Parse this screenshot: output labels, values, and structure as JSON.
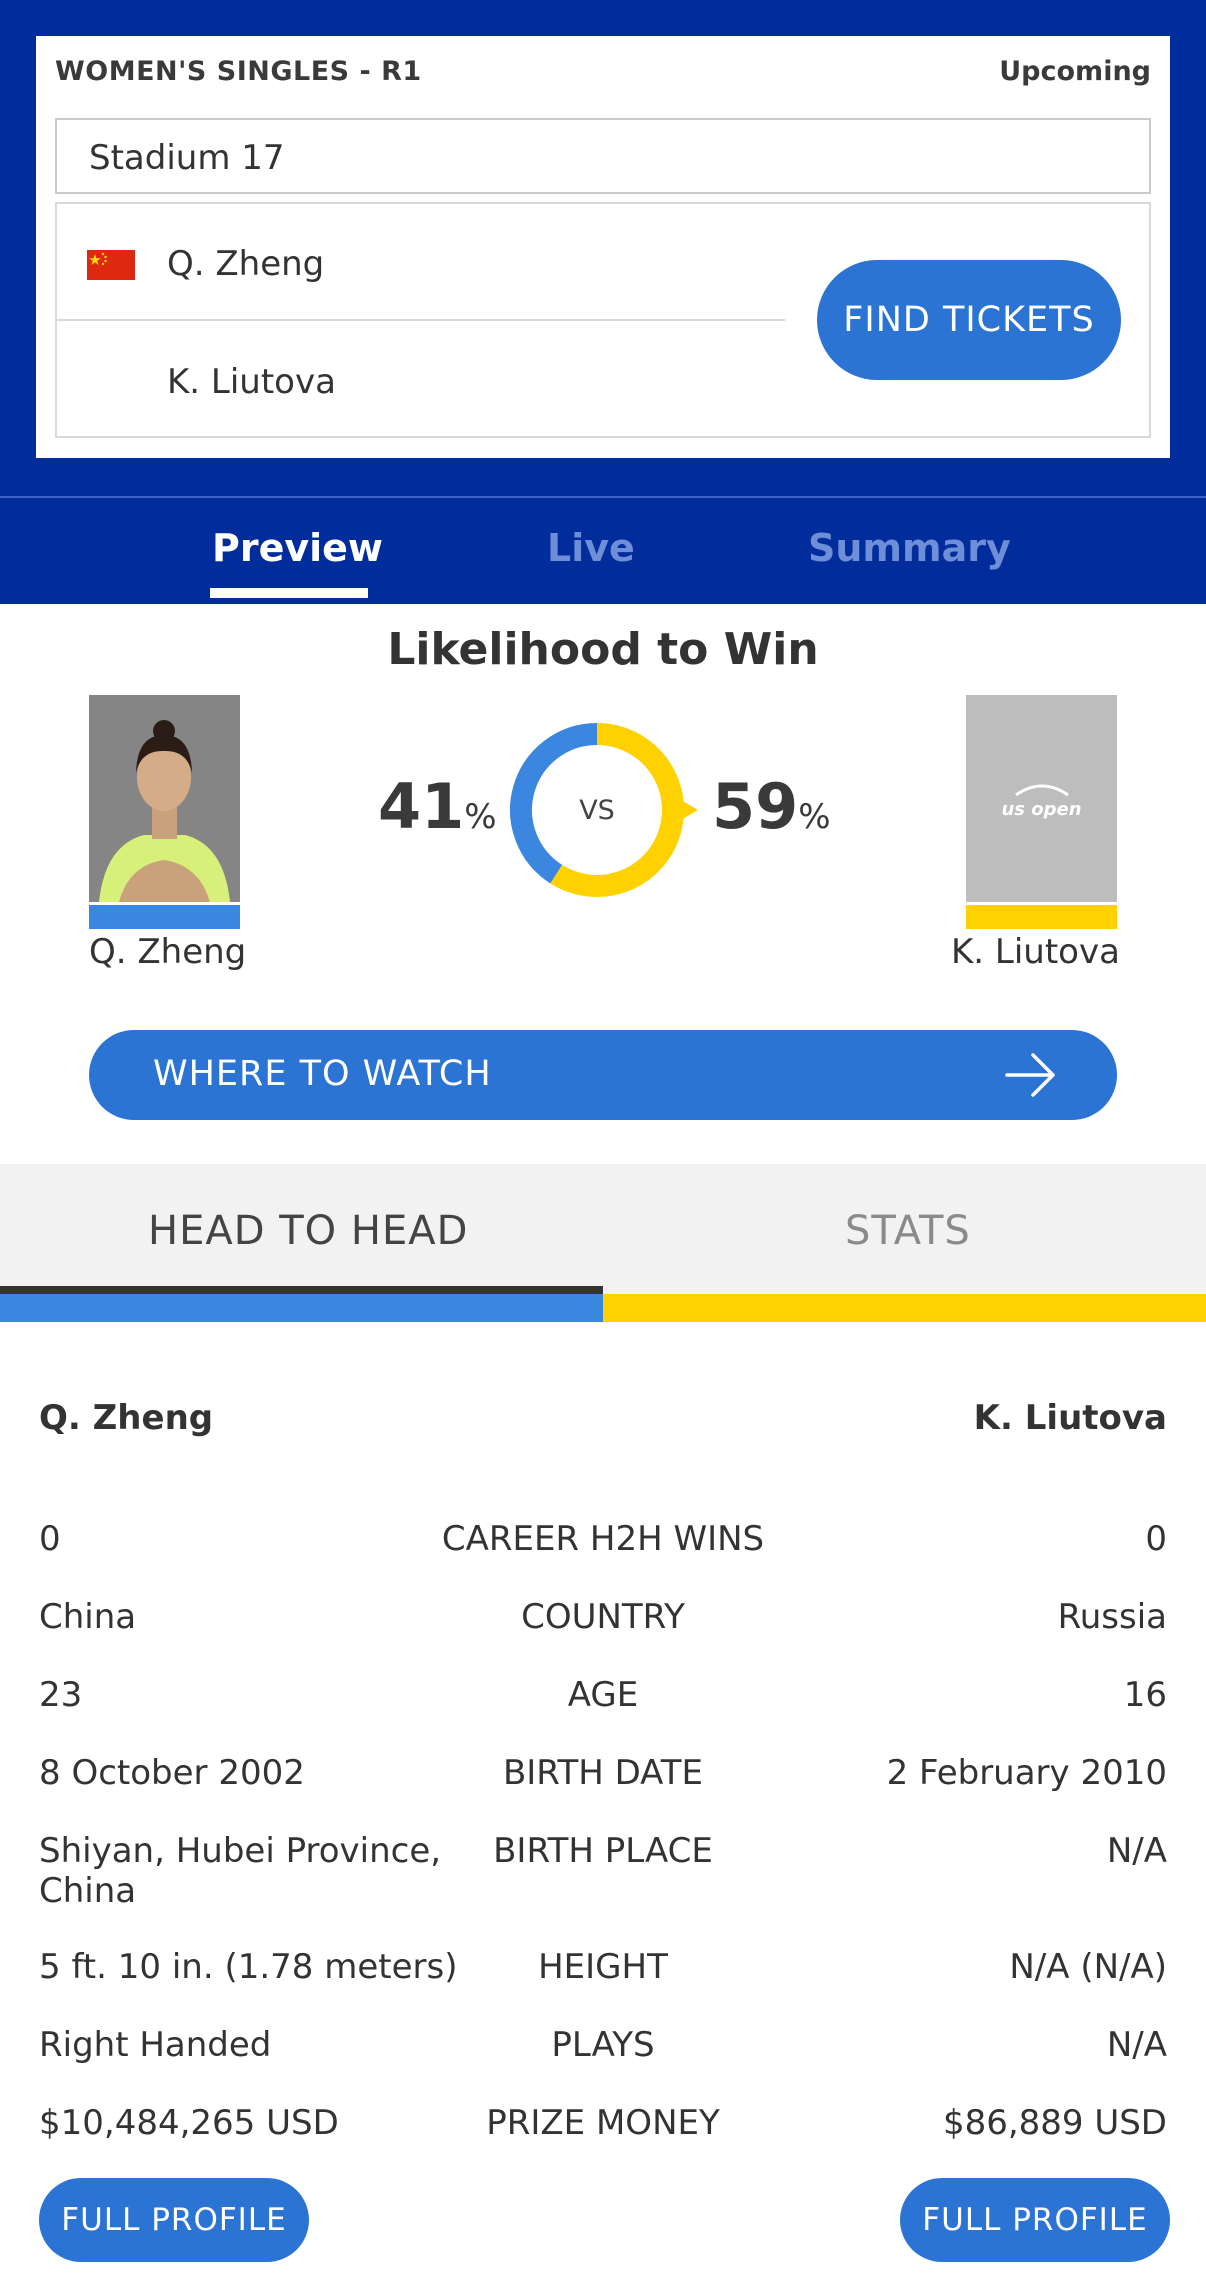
{
  "match": {
    "round": "WOMEN'S SINGLES - R1",
    "status": "Upcoming",
    "court": "Stadium 17",
    "player_a": "Q. Zheng",
    "player_b": "K. Liutova",
    "find_tickets_label": "FIND TICKETS"
  },
  "tabs": {
    "preview": "Preview",
    "live": "Live",
    "summary": "Summary",
    "active": "Preview"
  },
  "likelihood": {
    "title": "Likelihood to Win",
    "player_a": {
      "name": "Q. Zheng",
      "pct": "41",
      "value": 41,
      "color": "#3b87e0"
    },
    "player_b": {
      "name": "K. Liutova",
      "pct": "59",
      "value": 59,
      "color": "#ffd100"
    },
    "pct_sign": "%",
    "vs": "VS",
    "placeholder_logo": "us open"
  },
  "where_to_watch": {
    "label": "WHERE TO WATCH",
    "icon": "arrow-right-icon"
  },
  "h2h": {
    "tab_head": "HEAD TO HEAD",
    "tab_stats": "STATS",
    "name_a": "Q. Zheng",
    "name_b": "K. Liutova",
    "rows": [
      {
        "a": "0",
        "label": "CAREER H2H WINS",
        "b": "0"
      },
      {
        "a": "China",
        "label": "COUNTRY",
        "b": "Russia"
      },
      {
        "a": "23",
        "label": "AGE",
        "b": "16"
      },
      {
        "a": "8 October 2002",
        "label": "BIRTH DATE",
        "b": "2 February 2010"
      },
      {
        "a": "Shiyan, Hubei Province, China",
        "label": "BIRTH PLACE",
        "b": "N/A"
      },
      {
        "a": "5 ft. 10 in. (1.78 meters)",
        "label": "HEIGHT",
        "b": "N/A (N/A)"
      },
      {
        "a": "Right Handed",
        "label": "PLAYS",
        "b": "N/A"
      },
      {
        "a": "$10,484,265 USD",
        "label": "PRIZE MONEY",
        "b": "$86,889 USD"
      }
    ],
    "full_profile_label": "FULL PROFILE"
  },
  "colors": {
    "brand_navy": "#012d9c",
    "button_blue": "#2b74d3",
    "player_a": "#3b87e0",
    "player_b": "#ffd100"
  }
}
